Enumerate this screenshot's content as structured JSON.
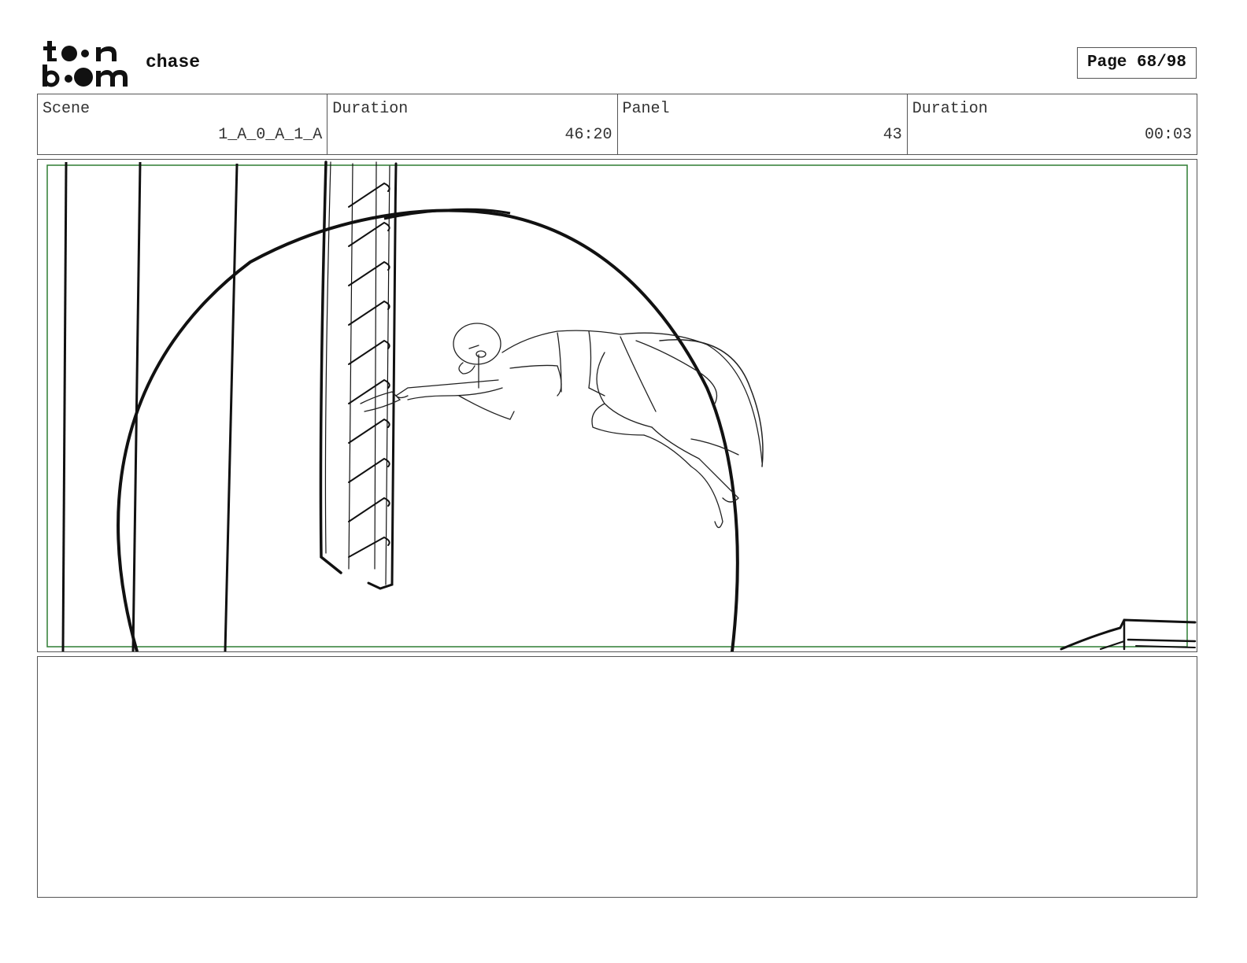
{
  "header": {
    "logo_text": "toon boom",
    "project_title": "chase",
    "page_indicator": "Page 68/98"
  },
  "info": {
    "scene_label": "Scene",
    "scene_value": "1_A_0_A_1_A",
    "scene_duration_label": "Duration",
    "scene_duration_value": "46:20",
    "panel_label": "Panel",
    "panel_value": "43",
    "panel_duration_label": "Duration",
    "panel_duration_value": "00:03"
  },
  "colors": {
    "safe_frame": "#2e7d32",
    "sketch_line": "#111111",
    "border": "#555555"
  },
  "notes": {
    "action_text": ""
  }
}
